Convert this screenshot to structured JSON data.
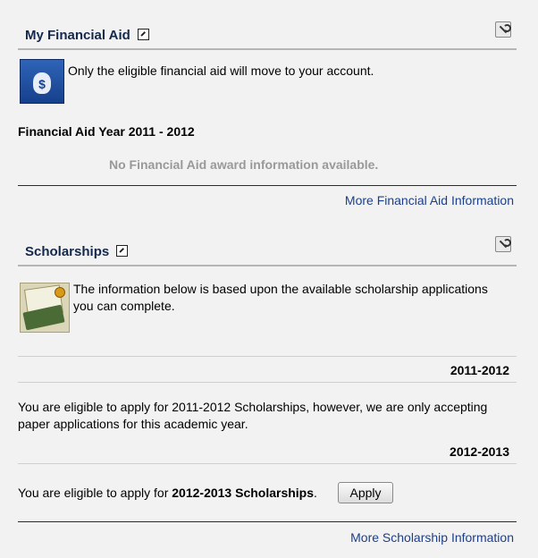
{
  "financial_aid": {
    "title": "My Financial Aid",
    "notice": "Only the eligible financial aid will move to your account.",
    "year_heading": "Financial Aid Year 2011 - 2012",
    "empty_message": "No Financial Aid award information available.",
    "more_link": "More Financial Aid Information"
  },
  "scholarships": {
    "title": "Scholarships",
    "intro_line1": "The information below is based upon the available scholarship applications",
    "intro_line2": "you can complete.",
    "year1": "2011-2012",
    "year1_text_line1": "You are eligible to apply for 2011-2012 Scholarships, however, we are only accepting",
    "year1_text_line2": "paper applications for this academic year.",
    "year2": "2012-2013",
    "year2_text_prefix": "You are eligible to apply for ",
    "year2_text_bold": "2012-2013 Scholarships",
    "year2_text_suffix": ".",
    "apply_label": "Apply",
    "more_link": "More Scholarship Information"
  },
  "icons": [
    "popout-icon",
    "wrench-icon",
    "money-bag-icon",
    "certificate-money-icon"
  ]
}
